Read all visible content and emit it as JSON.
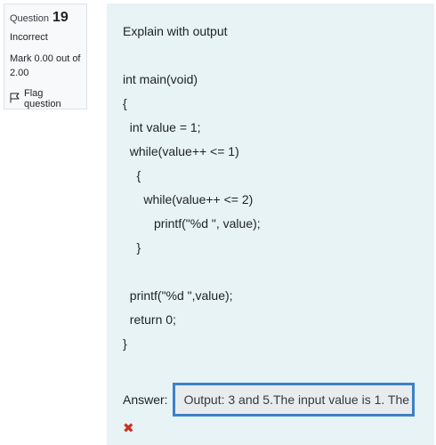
{
  "info": {
    "question_label": "Question",
    "question_number": "19",
    "state": "Incorrect",
    "grade": "Mark 0.00 out of 2.00",
    "flag_label": "Flag question"
  },
  "question": {
    "prompt": "Explain with output",
    "code_lines": [
      "int main(void)",
      "{",
      "  int value = 1;",
      "  while(value++ <= 1)",
      "    {",
      "      while(value++ <= 2)",
      "         printf(\"%d \", value);",
      "    }",
      "",
      "  printf(\"%d \",value);",
      "  return 0;",
      "}"
    ]
  },
  "answer": {
    "label": "Answer:",
    "value": "Output: 3 and 5.The input value is 1. The",
    "feedback_icon": "cross-icon",
    "feedback_color": "#ca3120"
  }
}
